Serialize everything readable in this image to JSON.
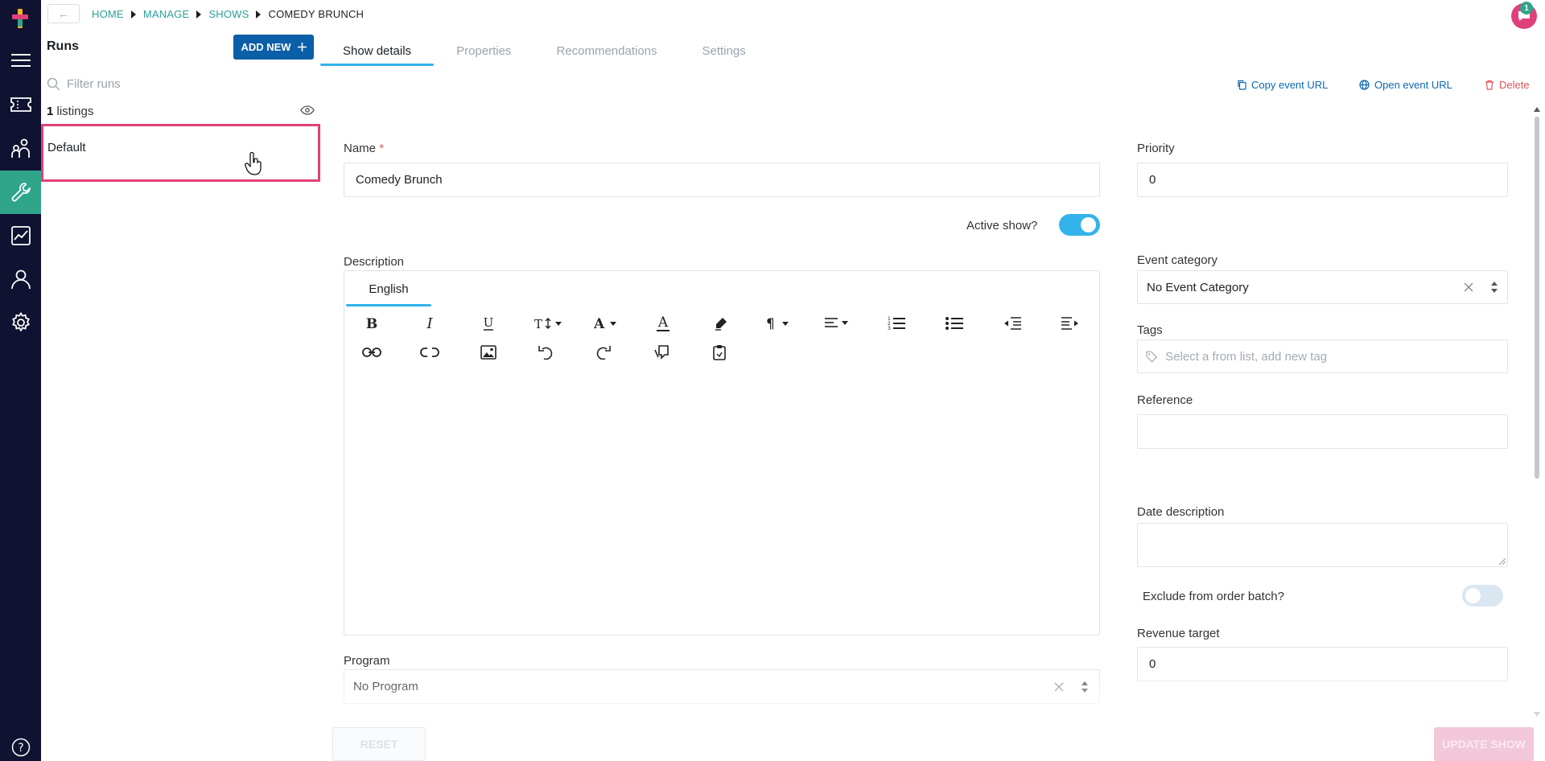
{
  "breadcrumb": {
    "back_label": "←",
    "items": [
      "HOME",
      "MANAGE",
      "SHOWS",
      "COMEDY BRUNCH"
    ]
  },
  "runs": {
    "title": "Runs",
    "add_new_label": "ADD NEW",
    "filter_placeholder": "Filter runs",
    "listings_count": "1",
    "listings_label": " listings",
    "items": [
      "Default"
    ]
  },
  "tabs": [
    "Show details",
    "Properties",
    "Recommendations",
    "Settings"
  ],
  "actions": {
    "copy_url": "Copy event URL",
    "open_url": "Open event URL",
    "delete": "Delete"
  },
  "form": {
    "name_label": "Name",
    "name_required": "*",
    "name_value": "Comedy Brunch",
    "active_label": "Active show?",
    "active_on": true,
    "description_label": "Description",
    "description_lang_tab": "English",
    "program_label": "Program",
    "program_value": "No Program",
    "priority_label": "Priority",
    "priority_value": "0",
    "event_category_label": "Event category",
    "event_category_value": "No Event Category",
    "tags_label": "Tags",
    "tags_placeholder": "Select a from list, add new tag",
    "reference_label": "Reference",
    "reference_value": "",
    "date_description_label": "Date description",
    "exclude_label": "Exclude from order batch?",
    "exclude_on": false,
    "revenue_label": "Revenue target",
    "revenue_value": "0"
  },
  "footer": {
    "reset_label": "RESET",
    "update_label": "UPDATE SHOW"
  },
  "notifications": {
    "count": "1"
  },
  "colors": {
    "nav_bg": "#0f1230",
    "nav_active": "#2fa58a",
    "primary_button": "#0b5ea8",
    "accent": "#32b3ec",
    "highlight": "#e0407a",
    "link": "#0b67b0",
    "danger": "#e05259"
  }
}
